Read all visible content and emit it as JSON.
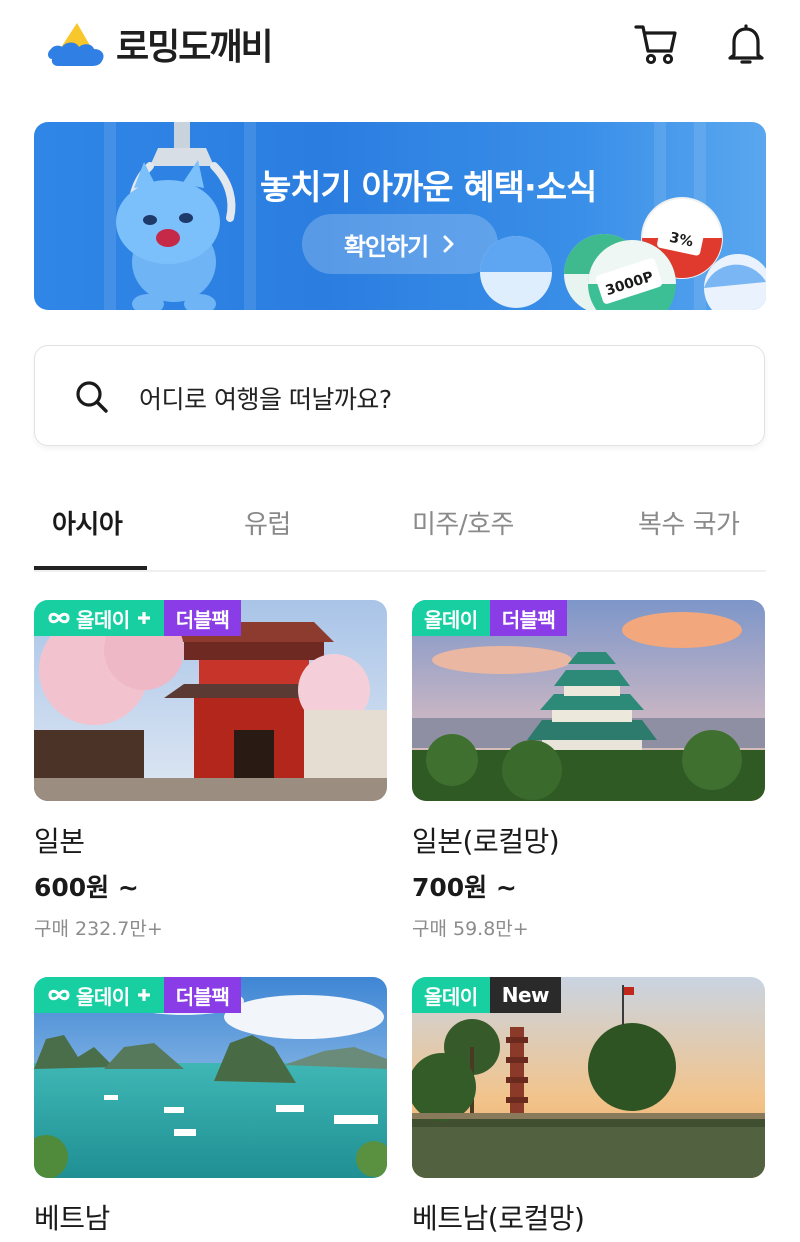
{
  "header": {
    "logo_text": "로밍도깨비",
    "cart_icon": "cart-icon",
    "bell_icon": "bell-icon"
  },
  "banner": {
    "title": "놓치기 아까운 혜택·소식",
    "button_label": "확인하기",
    "ball_labels": [
      "3%",
      "3000P"
    ]
  },
  "search": {
    "placeholder": "어디로 여행을 떠날까요?"
  },
  "tabs": [
    {
      "label": "아시아",
      "active": true
    },
    {
      "label": "유럽",
      "active": false
    },
    {
      "label": "미주/호주",
      "active": false
    },
    {
      "label": "복수 국가",
      "active": false
    }
  ],
  "products": [
    {
      "name": "일본",
      "price": "600원 ~",
      "sold": "구매 232.7만+",
      "badges": [
        "올데이",
        "더블팩"
      ],
      "allday_infinity": true,
      "allday_plus": true
    },
    {
      "name": "일본(로컬망)",
      "price": "700원 ~",
      "sold": "구매 59.8만+",
      "badges": [
        "올데이",
        "더블팩"
      ],
      "allday_infinity": false,
      "allday_plus": false
    },
    {
      "name": "베트남",
      "badges": [
        "올데이",
        "더블팩"
      ],
      "allday_infinity": true,
      "allday_plus": true
    },
    {
      "name": "베트남(로컬망)",
      "badges": [
        "올데이",
        "New"
      ],
      "allday_infinity": false,
      "allday_plus": false
    }
  ],
  "colors": {
    "allday_badge": "#17cfa1",
    "double_badge": "#8a3ce6",
    "new_badge": "#2a2a2a",
    "banner": "#2f86e6"
  }
}
